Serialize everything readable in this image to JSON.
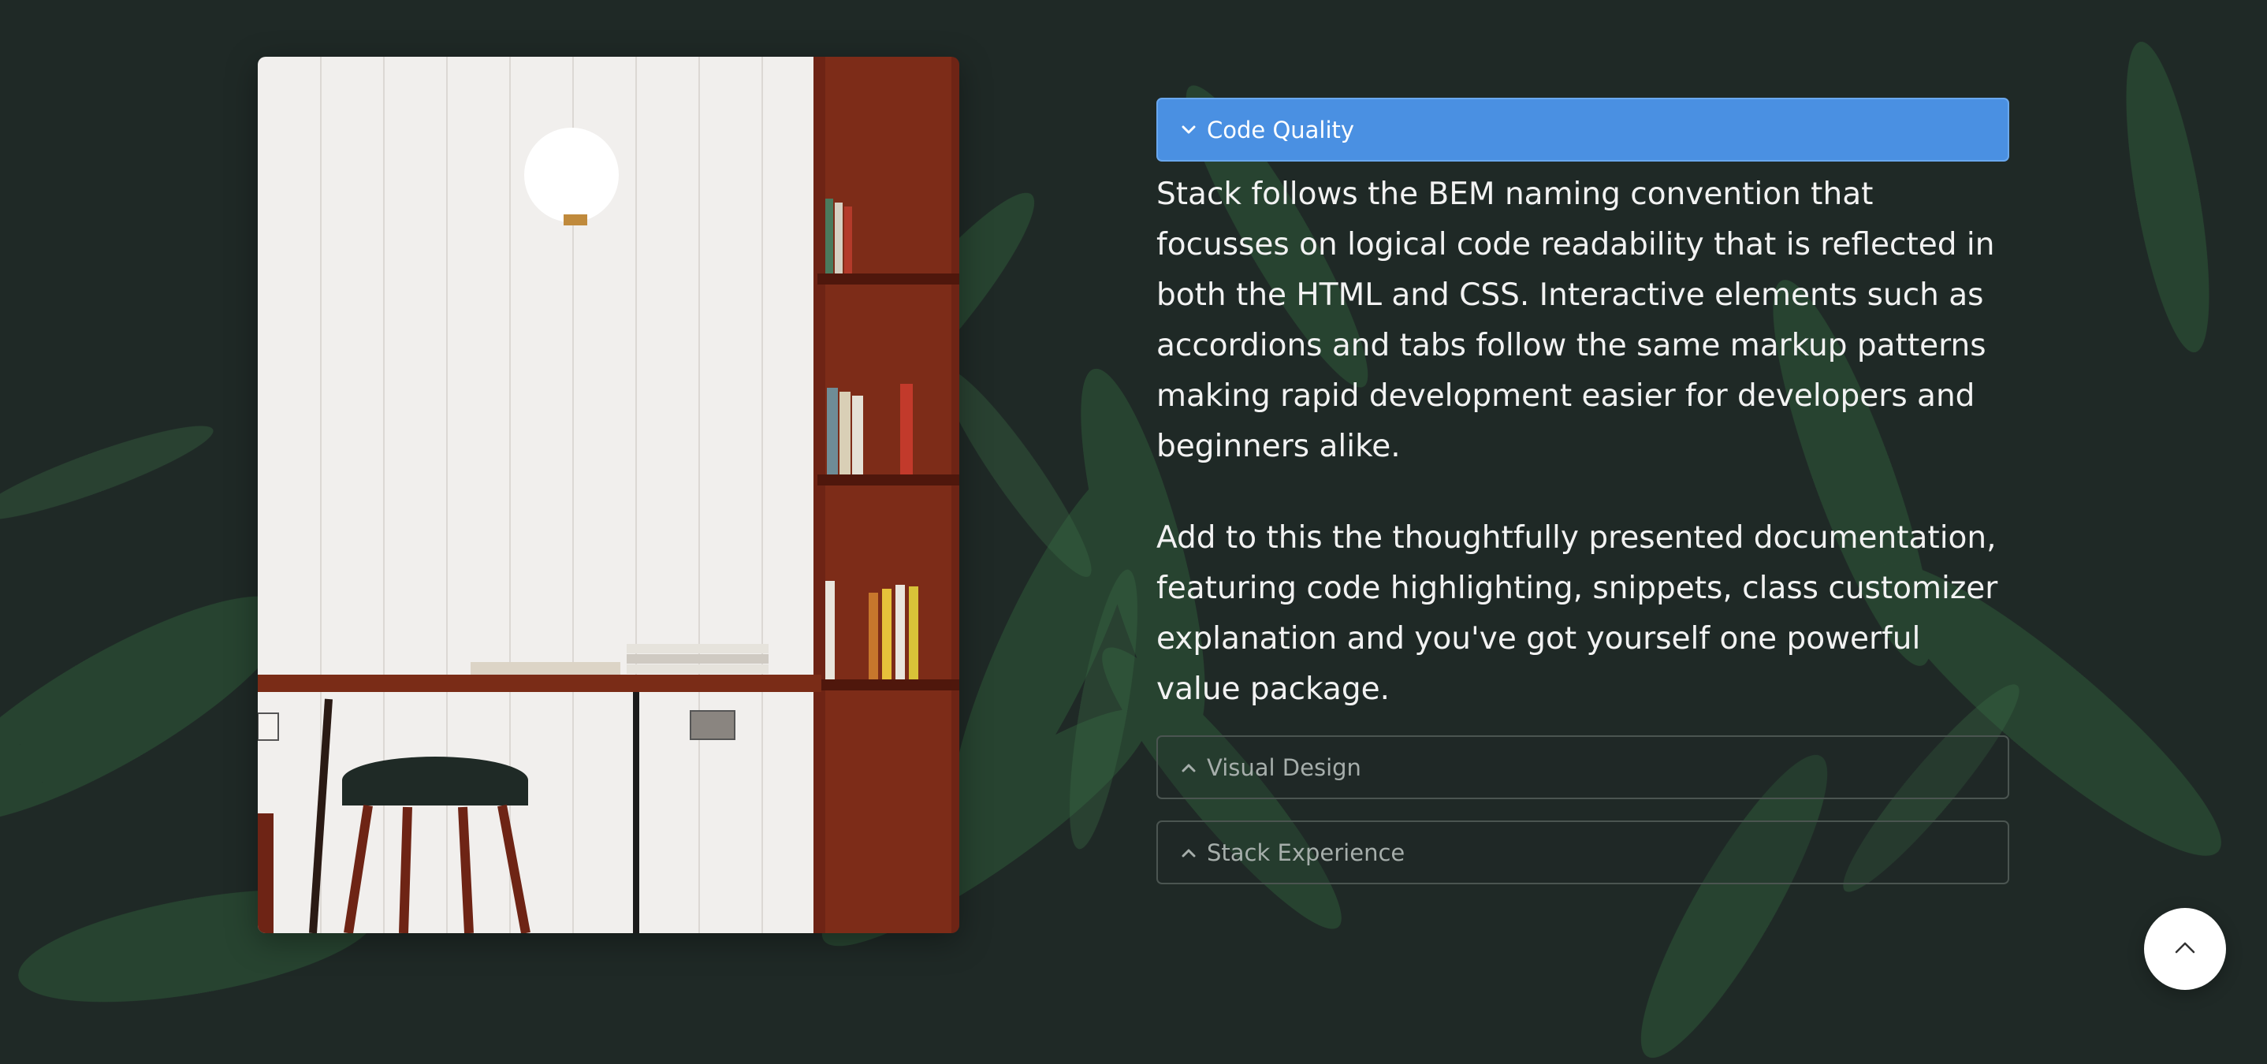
{
  "accordion": {
    "items": [
      {
        "title": "Code Quality",
        "state": "open",
        "icon": "chevron-down-icon",
        "paragraphs": [
          "Stack follows the BEM naming convention that focusses on logical code readability that is reflected in both the HTML and CSS. Interactive elements such as accordions and tabs follow the same markup patterns making rapid development easier for developers and beginners alike.",
          "Add to this the thoughtfully presented documentation, featuring code highlighting, snippets, class customizer explanation and you've got yourself one powerful value package."
        ]
      },
      {
        "title": "Visual Design",
        "state": "closed",
        "icon": "chevron-up-icon"
      },
      {
        "title": "Stack Experience",
        "state": "closed",
        "icon": "chevron-up-icon"
      }
    ]
  },
  "back_to_top": {
    "icon": "chevron-up-icon"
  },
  "colors": {
    "background": "#1f2926",
    "accent": "#4a90e2",
    "foliage": "#2f5a3a"
  }
}
